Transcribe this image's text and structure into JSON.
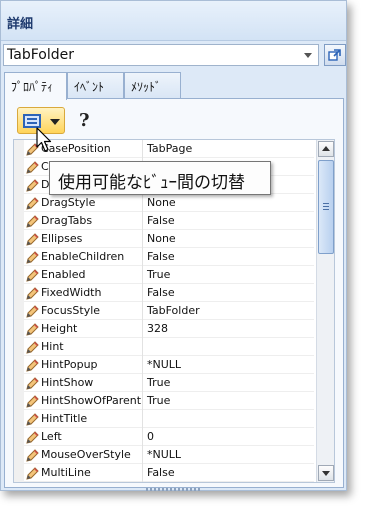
{
  "title": "詳細",
  "object_selector": {
    "value": "TabFolder"
  },
  "tabs": [
    {
      "label": "ﾌﾟﾛﾊﾟﾃｨ",
      "active": true
    },
    {
      "label": "ｲﾍﾞﾝﾄ",
      "active": false
    },
    {
      "label": "ﾒｿｯﾄﾞ",
      "active": false
    }
  ],
  "toolbar": {
    "help_glyph": "?"
  },
  "tooltip": "使用可能なﾋﾞｭｰ間の切替",
  "properties": [
    {
      "name": "CasePosition",
      "value": "TabPage"
    },
    {
      "name": "Cur",
      "value": ""
    },
    {
      "name": "Dis",
      "value": ""
    },
    {
      "name": "DragStyle",
      "value": "None"
    },
    {
      "name": "DragTabs",
      "value": "False"
    },
    {
      "name": "Ellipses",
      "value": "None"
    },
    {
      "name": "EnableChildren",
      "value": "False"
    },
    {
      "name": "Enabled",
      "value": "True"
    },
    {
      "name": "FixedWidth",
      "value": "False"
    },
    {
      "name": "FocusStyle",
      "value": "TabFolder"
    },
    {
      "name": "Height",
      "value": "328"
    },
    {
      "name": "Hint",
      "value": ""
    },
    {
      "name": "HintPopup",
      "value": "*NULL"
    },
    {
      "name": "HintShow",
      "value": "True"
    },
    {
      "name": "HintShowOfParent",
      "value": "True"
    },
    {
      "name": "HintTitle",
      "value": ""
    },
    {
      "name": "Left",
      "value": "0"
    },
    {
      "name": "MouseOverStyle",
      "value": "*NULL"
    },
    {
      "name": "MultiLine",
      "value": "False"
    }
  ]
}
